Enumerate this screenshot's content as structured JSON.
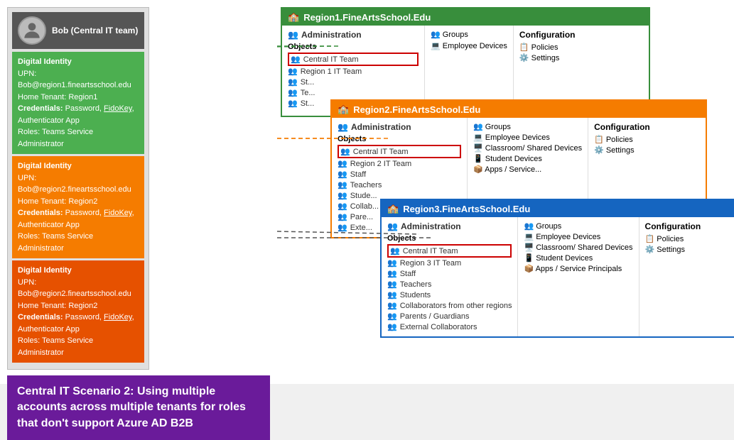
{
  "user": {
    "name": "Bob (Central IT team)",
    "avatar_label": "person"
  },
  "identity1": {
    "label": "Digital Identity",
    "upn": "UPN: Bob@region1.fineartsschool.edu",
    "home_tenant": "Home Tenant: Region1",
    "credentials": "Credentials: Password, FidoKey, Authenticator App",
    "roles": "Roles: Teams Service Administrator"
  },
  "identity2": {
    "label": "Digital Identity",
    "upn": "UPN: Bob@region2.fineartsschool.edu",
    "home_tenant": "Home Tenant: Region2",
    "credentials": "Credentials: Password, FidoKey, Authenticator App",
    "roles": "Roles: Teams Service Administrator"
  },
  "identity3": {
    "label": "Digital Identity",
    "upn": "UPN: Bob@region2.fineartsschool.edu",
    "home_tenant": "Home Tenant: Region2",
    "credentials": "Credentials: Password, FidoKey, Authenticator App",
    "roles": "Roles: Teams Service Administrator"
  },
  "caption": "Central IT Scenario 2: Using multiple accounts across multiple tenants for roles that don't support Azure AD B2B",
  "tenant1": {
    "title": "Region1.FineArtsSchool.Edu",
    "admin_label": "Administration",
    "config_label": "Configuration",
    "objects_label": "Objects",
    "objects": [
      {
        "name": "Central IT Team",
        "highlighted": true
      },
      {
        "name": "Region 1 IT Team",
        "highlighted": false
      },
      {
        "name": "St...",
        "highlighted": false
      },
      {
        "name": "Te...",
        "highlighted": false
      },
      {
        "name": "St...",
        "highlighted": false
      }
    ],
    "admin_items": [
      {
        "name": "Groups"
      },
      {
        "name": "Employee Devices"
      }
    ],
    "config_items": [
      {
        "name": "Policies"
      },
      {
        "name": "Settings"
      }
    ]
  },
  "tenant2": {
    "title": "Region2.FineArtsSchool.Edu",
    "admin_label": "Administration",
    "config_label": "Configuration",
    "objects_label": "Objects",
    "objects": [
      {
        "name": "Central IT Team",
        "highlighted": true
      },
      {
        "name": "Region 2 IT Team",
        "highlighted": false
      },
      {
        "name": "Staff",
        "highlighted": false
      },
      {
        "name": "Teachers",
        "highlighted": false
      },
      {
        "name": "Stude...",
        "highlighted": false
      },
      {
        "name": "Collab... other...",
        "highlighted": false
      },
      {
        "name": "Pare...",
        "highlighted": false
      },
      {
        "name": "Exte...",
        "highlighted": false
      }
    ],
    "admin_items": [
      {
        "name": "Groups"
      },
      {
        "name": "Employee Devices"
      },
      {
        "name": "Classroom/ Shared Devices"
      },
      {
        "name": "Student Devices"
      },
      {
        "name": "Apps / Service..."
      }
    ],
    "config_items": [
      {
        "name": "Policies"
      },
      {
        "name": "Settings"
      }
    ]
  },
  "tenant3": {
    "title": "Region3.FineArtsSchool.Edu",
    "admin_label": "Administration",
    "config_label": "Configuration",
    "objects_label": "Objects",
    "objects": [
      {
        "name": "Central IT Team",
        "highlighted": true
      },
      {
        "name": "Region 3 IT Team",
        "highlighted": false
      },
      {
        "name": "Staff",
        "highlighted": false
      },
      {
        "name": "Teachers",
        "highlighted": false
      },
      {
        "name": "Students",
        "highlighted": false
      },
      {
        "name": "Collaborators from other regions",
        "highlighted": false
      },
      {
        "name": "Parents / Guardians",
        "highlighted": false
      },
      {
        "name": "External Collaborators",
        "highlighted": false
      }
    ],
    "admin_items": [
      {
        "name": "Groups"
      },
      {
        "name": "Employee Devices"
      },
      {
        "name": "Classroom/ Shared Devices"
      },
      {
        "name": "Student Devices"
      },
      {
        "name": "Apps / Service Principals"
      }
    ],
    "config_items": [
      {
        "name": "Policies"
      },
      {
        "name": "Settings"
      }
    ]
  }
}
